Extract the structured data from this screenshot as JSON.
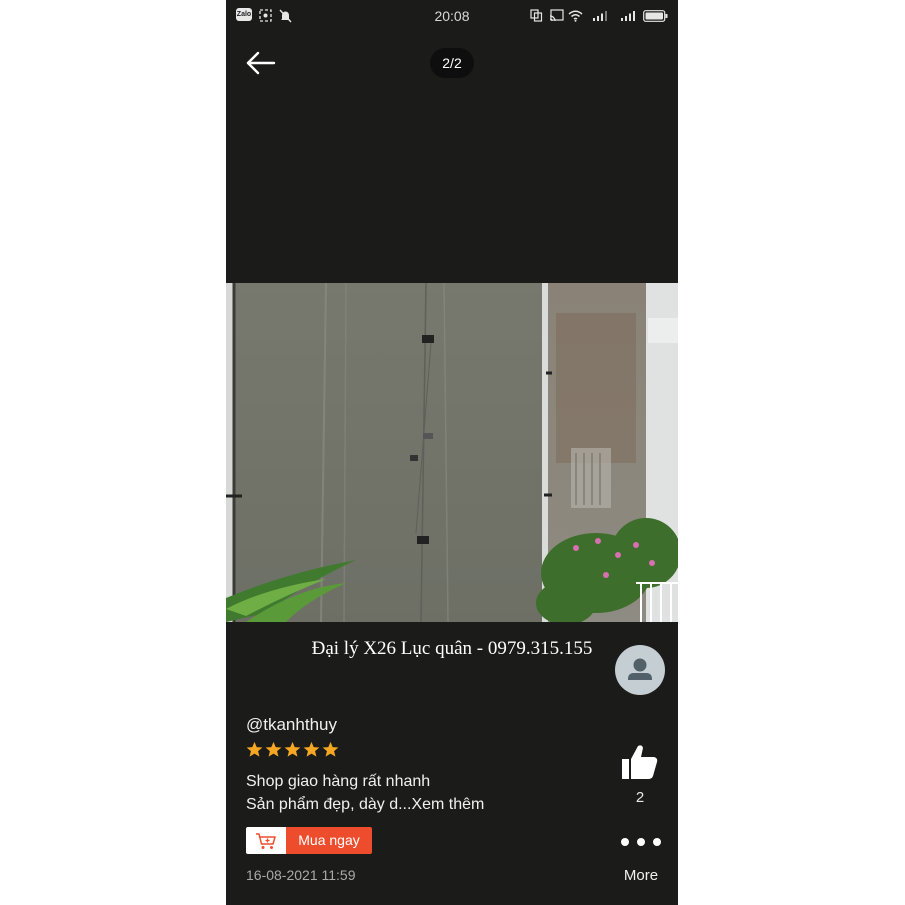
{
  "status_bar": {
    "time": "20:08",
    "left_icons": [
      "zalo-app-icon",
      "screenshot-icon",
      "mute-icon"
    ],
    "right_icons": [
      "sim-icon",
      "cast-icon",
      "wifi-icon",
      "signal-icon",
      "signal-icon",
      "battery-icon"
    ],
    "zalo_text": "Zalo"
  },
  "viewer": {
    "back_icon": "arrow-left-icon",
    "counter": "2/2"
  },
  "media": {
    "watermark": "Đại lý X26 Lục quân - 0979.315.155"
  },
  "review": {
    "username": "@tkanhthuy",
    "rating": 5,
    "lines": [
      "Shop giao hàng rất nhanh",
      "Sản phẩm đẹp, dày d...Xem thêm"
    ],
    "buy_label": "Mua ngay",
    "date": "16-08-2021 11:59"
  },
  "actions": {
    "like_count": "2",
    "more_label": "More"
  },
  "colors": {
    "background": "#1b1c1a",
    "accent": "#ee4d2d",
    "star": "#f5a623",
    "avatar": "#c4ced3"
  }
}
